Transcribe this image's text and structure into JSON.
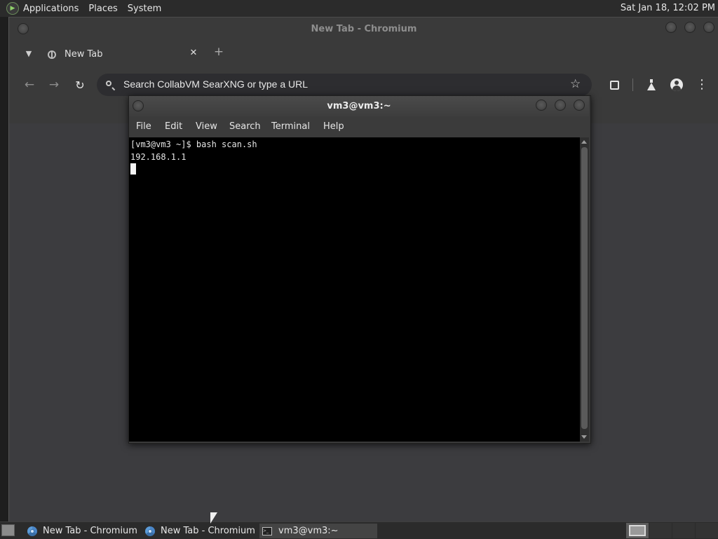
{
  "top_panel": {
    "menus": [
      "Applications",
      "Places",
      "System"
    ],
    "clock": "Sat Jan 18, 12:02 PM"
  },
  "browser": {
    "window_title": "New Tab - Chromium",
    "tab": {
      "title": "New Tab"
    },
    "omnibox": {
      "placeholder": "Search CollabVM SearXNG or type a URL"
    }
  },
  "terminal": {
    "window_title": "vm3@vm3:~",
    "menus": [
      "File",
      "Edit",
      "View",
      "Search",
      "Terminal",
      "Help"
    ],
    "lines": [
      "[vm3@vm3 ~]$ bash scan.sh",
      "192.168.1.1"
    ]
  },
  "taskbar": {
    "tasks": [
      {
        "label": "New Tab - Chromium",
        "icon": "chromium-icon",
        "active": false
      },
      {
        "label": "New Tab - Chromium",
        "icon": "chromium-icon",
        "active": false
      },
      {
        "label": "vm3@vm3:~",
        "icon": "terminal-icon",
        "active": true
      }
    ]
  },
  "icons": {
    "distro": "fedora-logo-icon",
    "tab_favicon": "globe-icon",
    "bookmark": "star-icon",
    "extensions": "puzzle-icon",
    "labs": "flask-icon",
    "profile": "avatar-icon",
    "menu": "kebab-menu-icon"
  }
}
